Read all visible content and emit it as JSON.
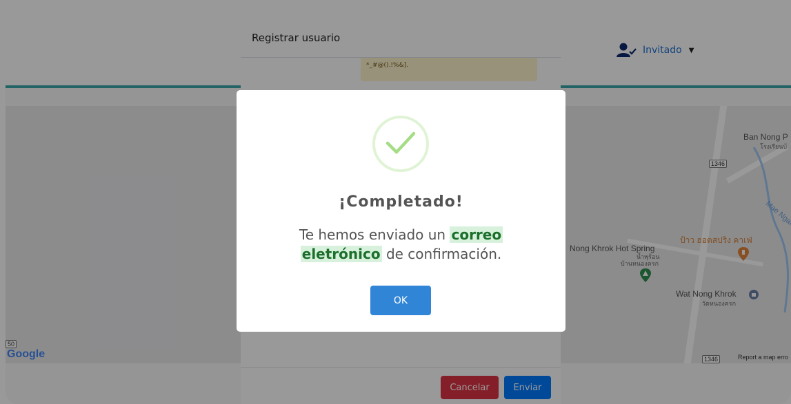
{
  "header": {
    "user_label": "Invitado"
  },
  "map": {
    "labels": {
      "ban_nong": "Ban Nong P",
      "ban_nong_thai": "โรงเรียนบ้",
      "nong_khrok_hot_spring": "Nong Khrok Hot Spring",
      "nong_khrok_thai": "น้ำพุร้อน",
      "nong_khrok_thai2": "บ้านหนองครก",
      "cafe_thai": "ป้าว ฮอตสปริง คาเฟ่",
      "wat_nong_khrok": "Wat Nong Khrok",
      "wat_thai": "วัดหนองครก",
      "mae_ngat": "Mae Ngat",
      "route_1346_a": "1346",
      "route_1346_b": "1346",
      "route_50": "50",
      "footer": "Report a map erro",
      "google": "Google"
    }
  },
  "register_dialog": {
    "title": "Registrar usuario",
    "warning_text": "*_#@().!%&].",
    "cancel_label": "Cancelar",
    "send_label": "Enviar"
  },
  "popup": {
    "title": "¡Completado!",
    "text_before": "Te hemos enviado un ",
    "text_highlight_1": "correo",
    "text_highlight_2": "eletrónico",
    "text_after": " de confirmación.",
    "ok_label": "OK"
  },
  "colors": {
    "accent": "#3085d6",
    "success": "#a5dc86",
    "danger": "#dc3545",
    "primary": "#007bff"
  }
}
